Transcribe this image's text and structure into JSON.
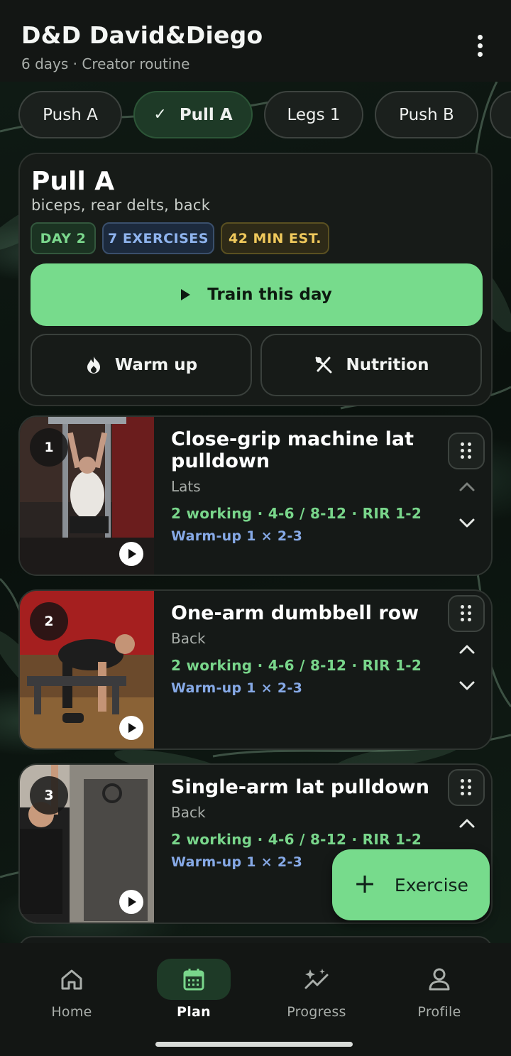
{
  "header": {
    "title": "D&D David&Diego",
    "subtitle": "6 days · Creator routine"
  },
  "tabs": [
    {
      "label": "Push A",
      "active": false
    },
    {
      "label": "Pull A",
      "active": true
    },
    {
      "label": "Legs 1",
      "active": false
    },
    {
      "label": "Push B",
      "active": false
    }
  ],
  "day": {
    "title": "Pull A",
    "muscles": "biceps, rear delts, back",
    "badges": {
      "day": "DAY 2",
      "exercises": "7 EXERCISES",
      "time": "42 MIN EST."
    },
    "train_label": "Train this day",
    "warmup_label": "Warm up",
    "nutrition_label": "Nutrition"
  },
  "exercises": [
    {
      "num": "1",
      "name": "Close-grip machine lat pulldown",
      "muscle": "Lats",
      "working": "2 working · 4-6 / 8-12 · RIR 1-2",
      "warmup": "Warm-up 1 × 2-3"
    },
    {
      "num": "2",
      "name": "One-arm dumbbell row",
      "muscle": "Back",
      "working": "2 working · 4-6 / 8-12 · RIR 1-2",
      "warmup": "Warm-up 1 × 2-3"
    },
    {
      "num": "3",
      "name": "Single-arm lat pulldown",
      "muscle": "Back",
      "working": "2 working · 4-6 / 8-12 · RIR 1-2",
      "warmup": "Warm-up 1 × 2-3"
    }
  ],
  "fab_label": "Exercise",
  "nav": [
    {
      "label": "Home",
      "icon": "home-icon",
      "active": false
    },
    {
      "label": "Plan",
      "icon": "calendar-icon",
      "active": true
    },
    {
      "label": "Progress",
      "icon": "sparkle-chart-icon",
      "active": false
    },
    {
      "label": "Profile",
      "icon": "person-icon",
      "active": false
    }
  ],
  "colors": {
    "accent": "#77db8c",
    "background": "#0b0f0c",
    "card": "#171b18"
  }
}
